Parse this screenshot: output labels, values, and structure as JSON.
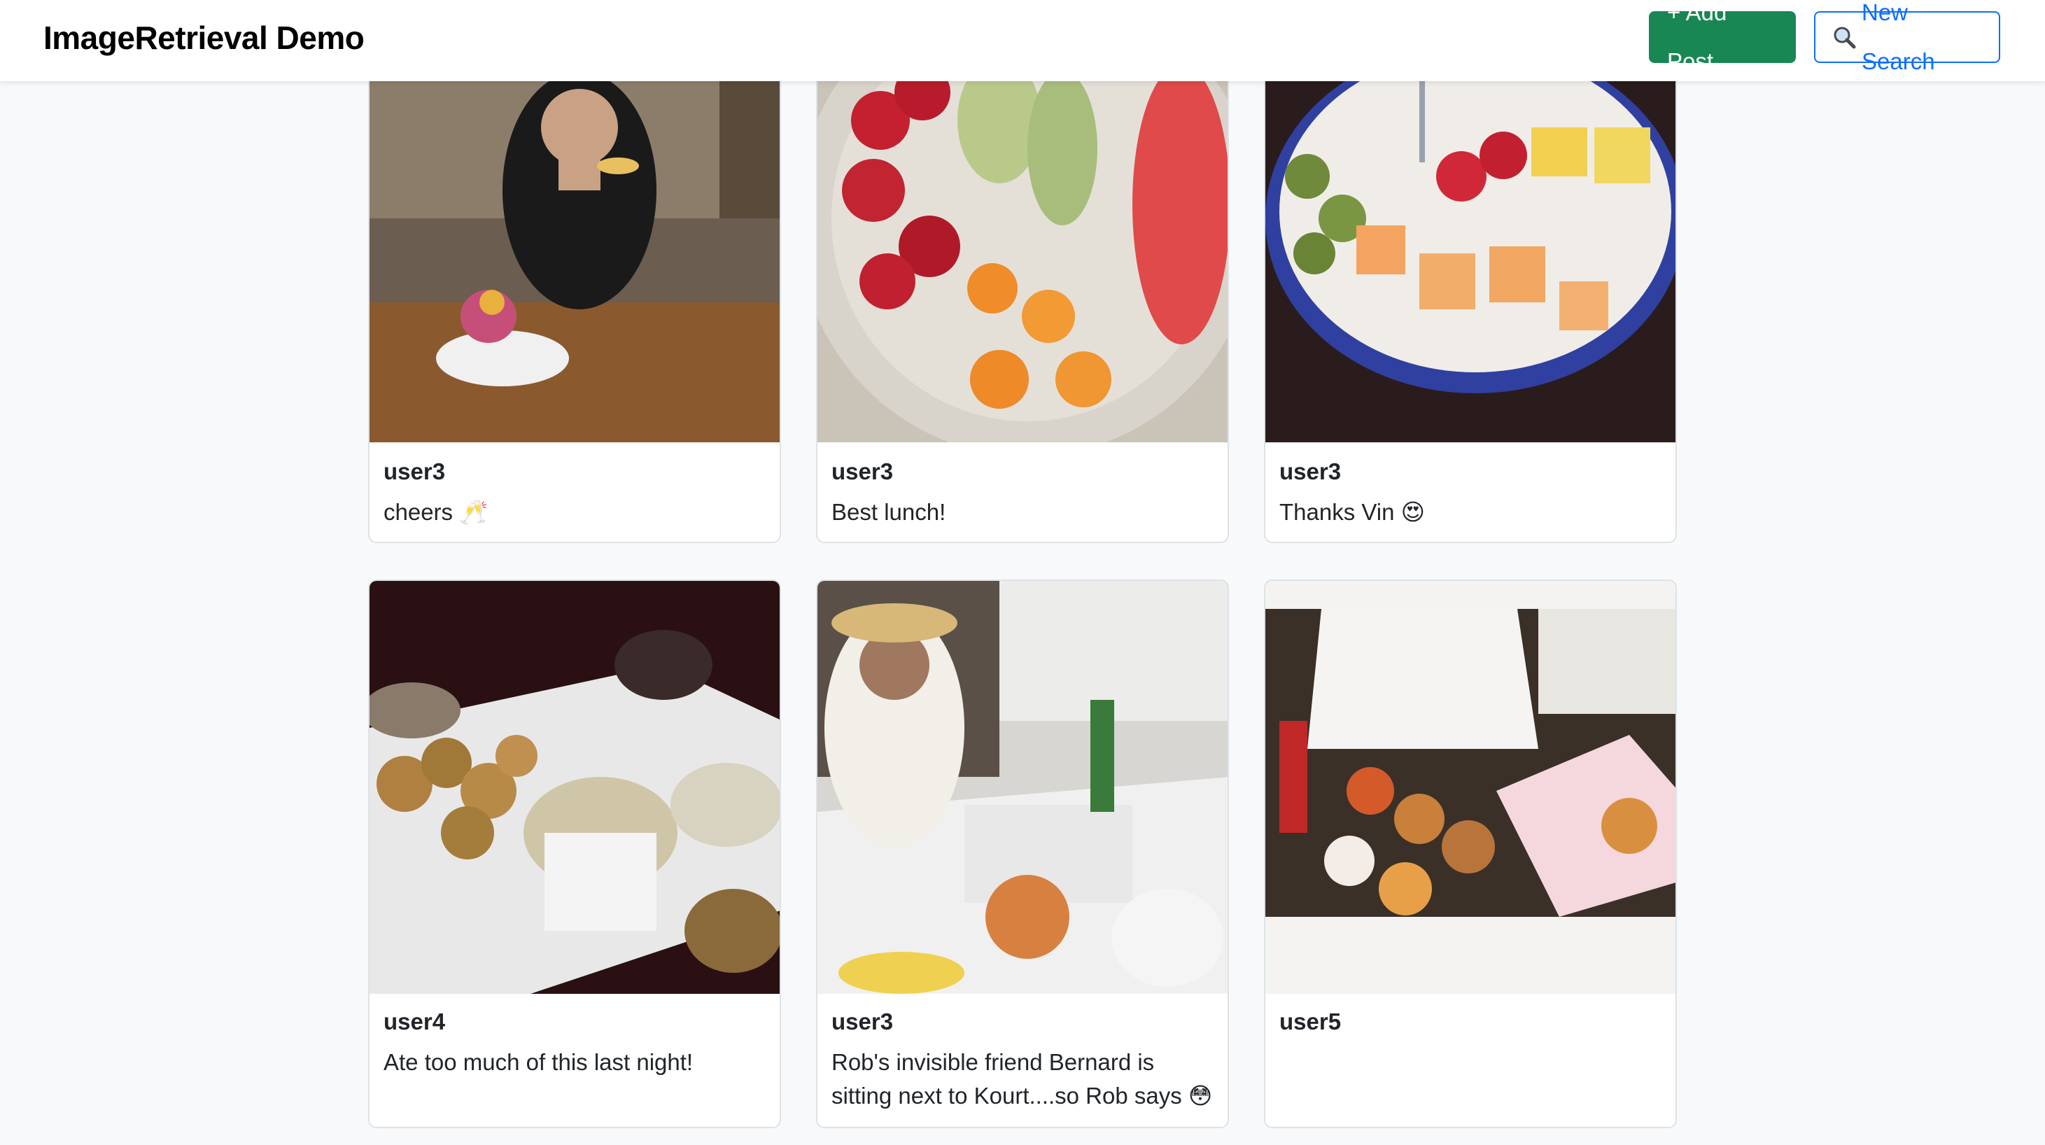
{
  "app": {
    "brand": "ImageRetrieval Demo"
  },
  "toolbar": {
    "add_post_label": "+ Add Post",
    "new_search_label": "New Search",
    "new_search_icon": "magnifier-icon"
  },
  "colors": {
    "success": "#198754",
    "primary": "#0d6efd",
    "background": "#f8f9fa"
  },
  "posts": [
    {
      "username": "user3",
      "caption": "cheers 🥂",
      "image": "woman-drinking-cocktail-with-dessert"
    },
    {
      "username": "user3",
      "caption": "Best lunch!",
      "image": "plate-of-strawberries-melon-oranges"
    },
    {
      "username": "user3",
      "caption": "Thanks Vin 😍",
      "image": "bowl-of-fruit-salad"
    },
    {
      "username": "user4",
      "caption": "Ate too much of this last night!",
      "image": "dessert-platter"
    },
    {
      "username": "user3",
      "caption": "Rob's invisible friend Bernard is sitting next to Kourt....so Rob says 😳",
      "image": "woman-at-restaurant-table"
    },
    {
      "username": "user5",
      "caption": "",
      "image": "person-with-donuts"
    }
  ]
}
